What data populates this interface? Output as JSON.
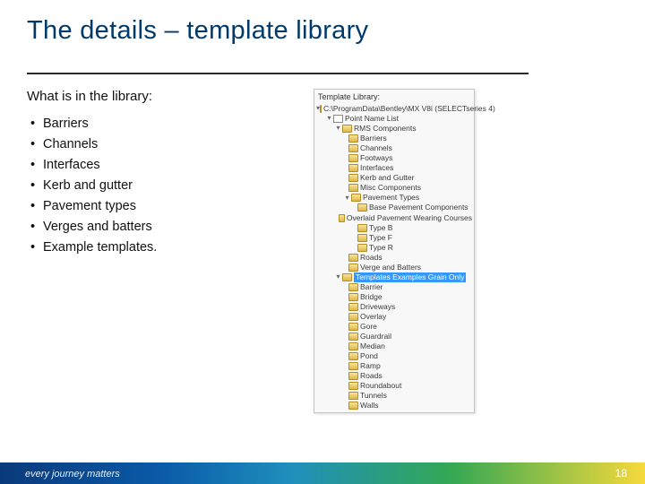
{
  "title": "The details – template library",
  "question": "What is in the library:",
  "bullets": [
    "Barriers",
    "Channels",
    "Interfaces",
    "Kerb and gutter",
    "Pavement types",
    "Verges and batters",
    "Example templates."
  ],
  "panel": {
    "title": "Template Library:",
    "root": "C:\\ProgramData\\Bentley\\MX V8i (SELECTseries 4)",
    "pointList": "Point Name List",
    "rmsTop": "RMS Components",
    "rmsItems": [
      "Barriers",
      "Channels",
      "Footways",
      "Interfaces",
      "Kerb and Gutter",
      "Misc Components"
    ],
    "pavementTypes": "Pavement Types",
    "pavementSub": [
      "Base Pavement Components",
      "Overlaid Pavement Wearing Courses",
      "Type B",
      "Type F",
      "Type R"
    ],
    "afterPavement": [
      "Roads",
      "Verge and Batters"
    ],
    "highlightedFolder": "Templates Examples Grain Only",
    "examples": [
      "Barrier",
      "Bridge",
      "Driveways",
      "Overlay",
      "Gore",
      "Guardrail",
      "Median",
      "Pond",
      "Ramp",
      "Roads",
      "Roundabout",
      "Tunnels",
      "Walls"
    ]
  },
  "footer": {
    "tagline": "every journey matters",
    "pageNumber": "18"
  }
}
